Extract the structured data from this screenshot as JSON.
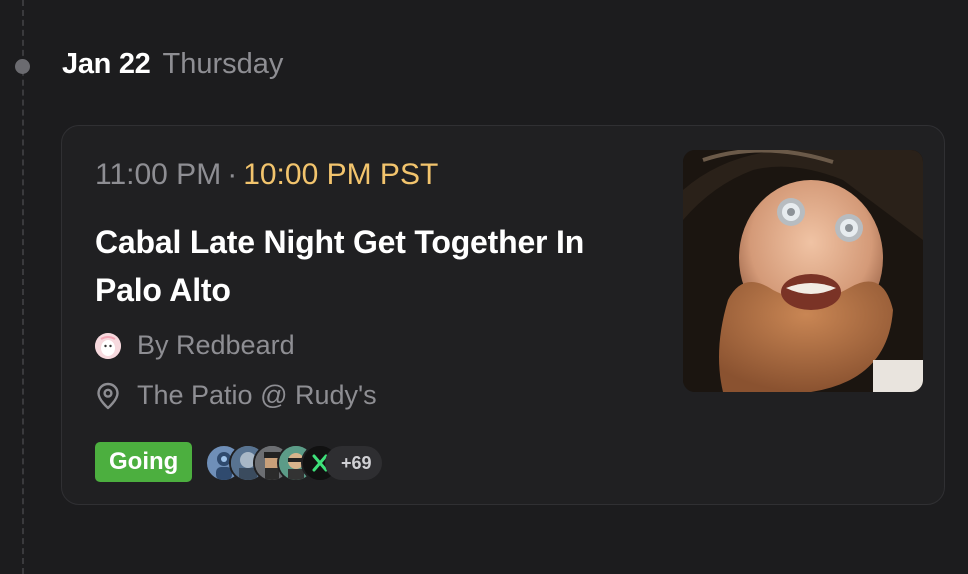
{
  "date": {
    "day": "Jan 22",
    "weekday": "Thursday"
  },
  "event": {
    "time_primary": "11:00 PM",
    "separator": "·",
    "time_local": "10:00 PM PST",
    "title": "Cabal Late Night Get Together In Palo Alto",
    "host": "By Redbeard",
    "location": "The Patio @ Rudy's",
    "status": "Going",
    "extra_attendees": "+69"
  },
  "icons": {
    "timeline": "timeline-dot-icon",
    "host": "host-avatar",
    "location": "map-pin-icon"
  },
  "colors": {
    "background": "#1c1c1e",
    "card": "#202022",
    "accent_time": "#f2c46d",
    "going": "#4caf3f",
    "muted_text": "#8e8e93"
  }
}
